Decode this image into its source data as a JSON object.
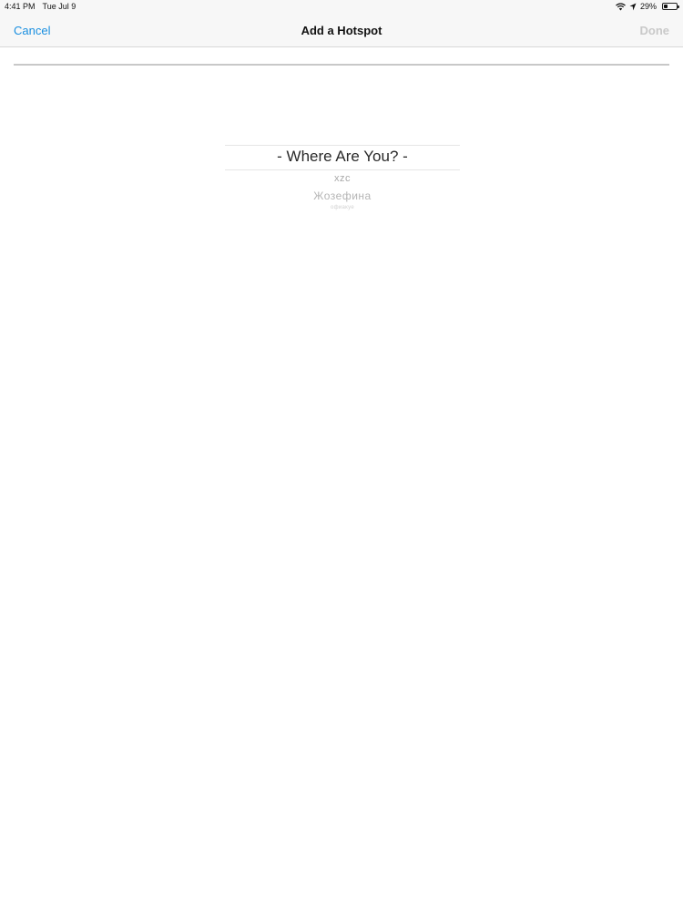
{
  "status_bar": {
    "time": "4:41 PM",
    "date": "Tue Jul 9",
    "battery_percent_text": "29%",
    "battery_level": 0.29,
    "icons": [
      "wifi-icon",
      "location-icon",
      "battery-icon"
    ]
  },
  "nav": {
    "cancel_label": "Cancel",
    "title": "Add a Hotspot",
    "done_label": "Done",
    "cancel_color": "#1a8fe0",
    "done_color_disabled": "#c9c9c9"
  },
  "hotspot_name_field": {
    "value": "",
    "placeholder": ""
  },
  "location_picker": {
    "selected": "- Where Are You? -",
    "options_below": [
      "xzc",
      "Жозефина",
      "офиакуе"
    ]
  }
}
